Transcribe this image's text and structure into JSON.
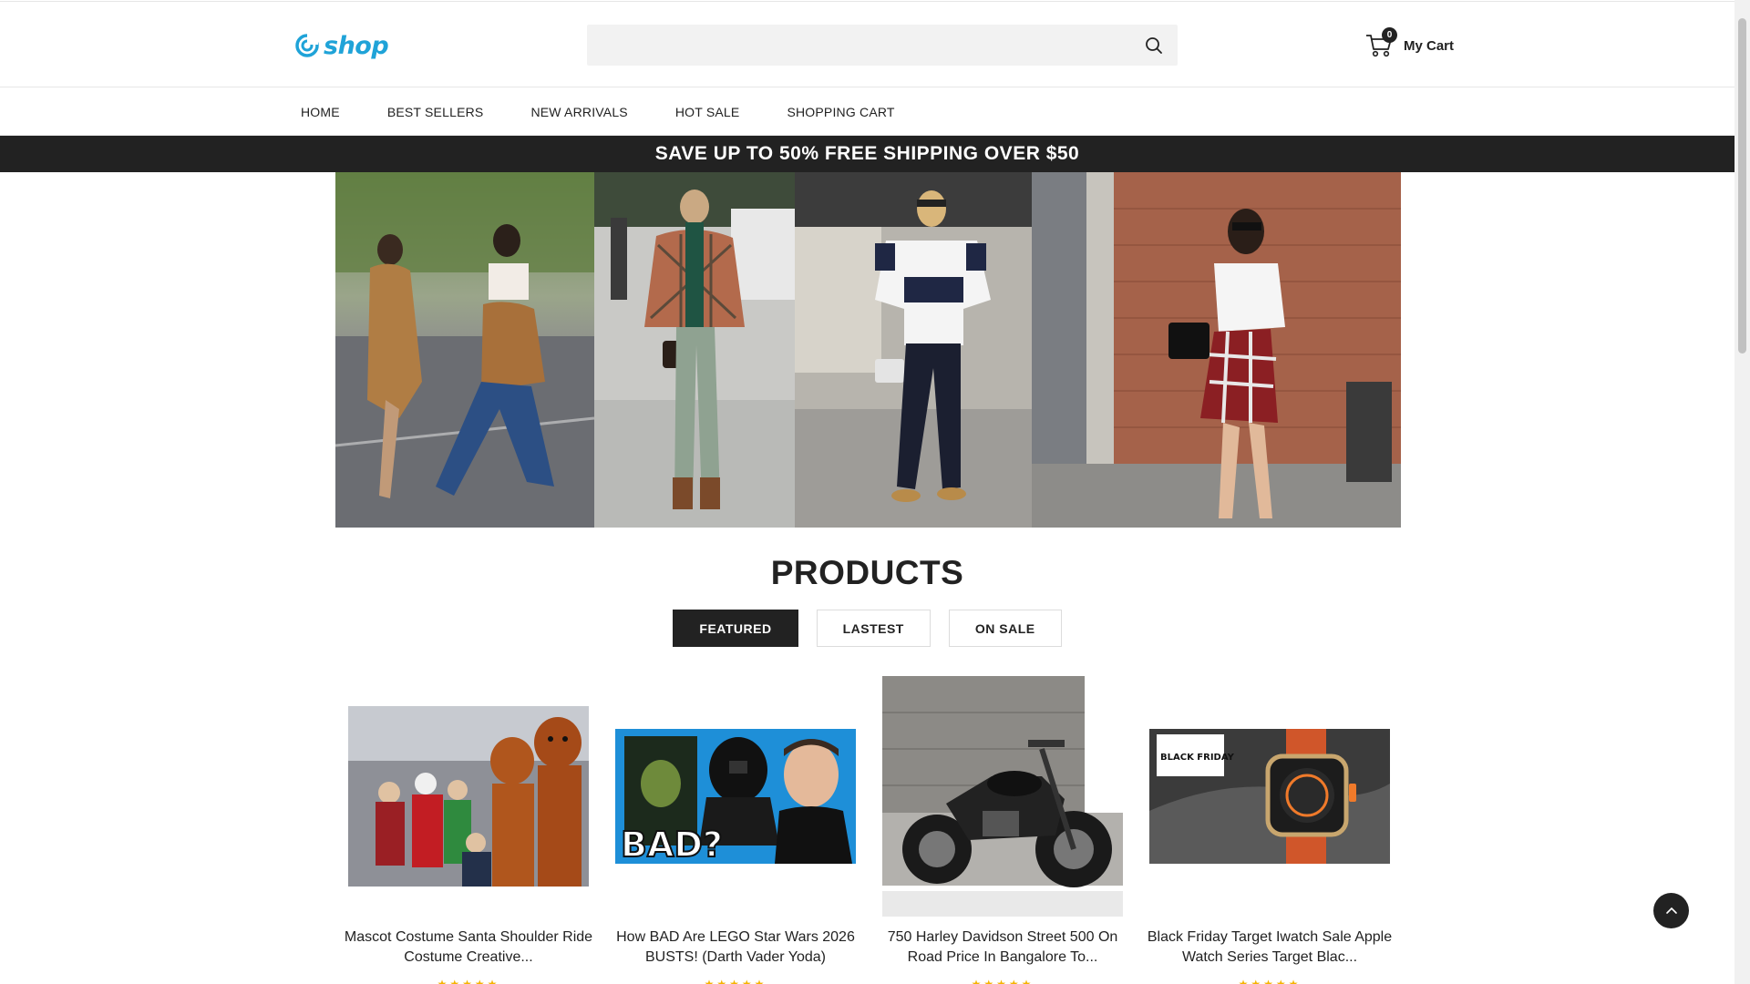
{
  "header": {
    "logo_text": "shop",
    "search": {
      "placeholder": "",
      "value": ""
    },
    "cart": {
      "count": "0",
      "label": "My Cart"
    }
  },
  "nav": {
    "items": [
      {
        "label": "HOME"
      },
      {
        "label": "BEST SELLERS"
      },
      {
        "label": "NEW ARRIVALS"
      },
      {
        "label": "HOT SALE"
      },
      {
        "label": "SHOPPING CART"
      }
    ]
  },
  "promo": {
    "text": "SAVE UP TO 50% FREE SHIPPING OVER $50"
  },
  "products": {
    "title": "PRODUCTS",
    "tabs": [
      {
        "label": "FEATURED",
        "active": true
      },
      {
        "label": "LASTEST",
        "active": false
      },
      {
        "label": "ON SALE",
        "active": false
      }
    ],
    "items": [
      {
        "title": "Mascot Costume Santa Shoulder Ride Costume Creative...",
        "rating": "★★★★★",
        "image": "mascot-costume-photo"
      },
      {
        "title": "How BAD Are LEGO Star Wars 2026 BUSTS! (Darth Vader Yoda)",
        "rating": "★★★★★",
        "image": "lego-star-wars-busts-photo",
        "image_text": "BAD?"
      },
      {
        "title": "750 Harley Davidson Street 500 On Road Price In Bangalore To...",
        "rating": "★★★★★",
        "image": "harley-davidson-motorcycle-photo"
      },
      {
        "title": "Black Friday Target Iwatch Sale Apple Watch Series Target Blac...",
        "rating": "★★★★★",
        "image": "apple-watch-black-friday-photo",
        "image_text": "BLACK FRIDAY"
      }
    ]
  },
  "colors": {
    "brand": "#1fa3d8",
    "dark": "#222222",
    "star": "#f5b301"
  }
}
